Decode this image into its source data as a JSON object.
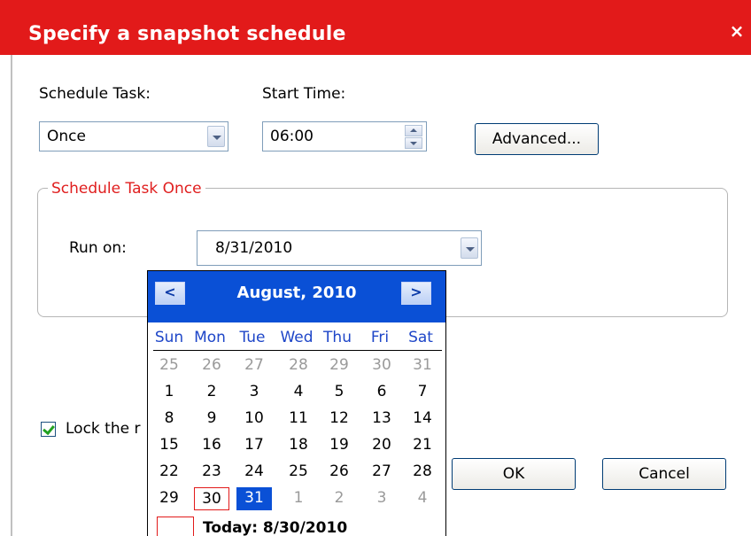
{
  "window": {
    "title": "Specify a snapshot schedule",
    "close_glyph": "×"
  },
  "schedule_task": {
    "label": "Schedule Task:",
    "value": "Once"
  },
  "start_time": {
    "label": "Start Time:",
    "value": "06:00"
  },
  "advanced_button": "Advanced...",
  "group": {
    "legend": "Schedule Task Once",
    "run_on_label": "Run on:",
    "run_on_value": "8/31/2010"
  },
  "lock_checkbox": {
    "label": "Lock the r",
    "checked": true
  },
  "ok_button": "OK",
  "cancel_button": "Cancel",
  "calendar": {
    "month": "August, 2010",
    "prev_glyph": "<",
    "next_glyph": ">",
    "weekdays": [
      "Sun",
      "Mon",
      "Tue",
      "Wed",
      "Thu",
      "Fri",
      "Sat"
    ],
    "weeks": [
      [
        "25",
        "26",
        "27",
        "28",
        "29",
        "30",
        "31"
      ],
      [
        "1",
        "2",
        "3",
        "4",
        "5",
        "6",
        "7"
      ],
      [
        "8",
        "9",
        "10",
        "11",
        "12",
        "13",
        "14"
      ],
      [
        "15",
        "16",
        "17",
        "18",
        "19",
        "20",
        "21"
      ],
      [
        "22",
        "23",
        "24",
        "25",
        "26",
        "27",
        "28"
      ],
      [
        "29",
        "30",
        "31",
        "1",
        "2",
        "3",
        "4"
      ]
    ],
    "today_date": "30",
    "selected_date": "31",
    "today_label": "Today: 8/30/2010"
  },
  "colors": {
    "titlebar": "#e21a1a",
    "calendar_header": "#0a50d6",
    "legend": "#e01e1e"
  }
}
